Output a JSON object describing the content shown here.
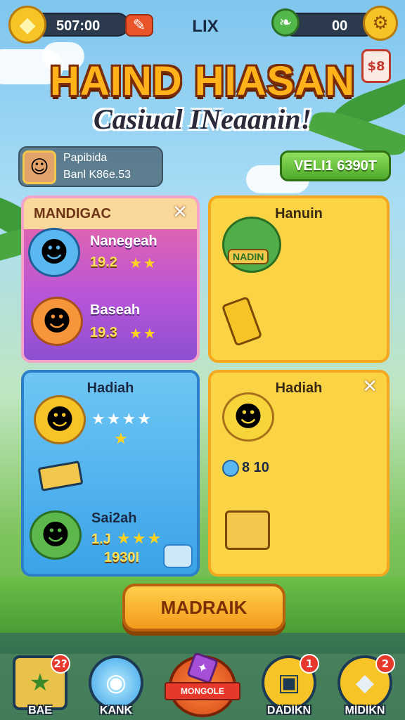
{
  "topbar": {
    "coins_value": "507:00",
    "title": "LIX",
    "gems_value": "00",
    "coin_icon": "diamond-coin-icon",
    "gem_icon": "leaf-gem-icon"
  },
  "header": {
    "title": "HAIND HIASAN",
    "subtitle": "Casiual INeaanin!",
    "badge_text": "$8"
  },
  "player": {
    "name": "Papibida",
    "score": "Banl K86e.53"
  },
  "green_button": "VELI1 6390T",
  "panels": {
    "magic": {
      "title": "MANDIGAC",
      "items": [
        {
          "name": "Nanegeah",
          "value": "19.2"
        },
        {
          "name": "Baseah",
          "value": "19.3"
        }
      ]
    },
    "hanuin": {
      "title": "Hanuin",
      "badge_text": "NADIN"
    },
    "hadiah_blue": {
      "title": "Hadiah",
      "item_name": "Sai2ah",
      "values_top": "1.J",
      "values_bottom": "1930I"
    },
    "hadiah_yellow": {
      "title": "Hadiah",
      "value": "8 10"
    }
  },
  "main_button": "MADRAIK",
  "nav": [
    {
      "label": "BAE",
      "badge": "2?",
      "icon": "star-icon"
    },
    {
      "label": "KANK",
      "badge": "",
      "icon": "globe-icon"
    },
    {
      "label": "MONGOLE",
      "badge": "",
      "icon": "gem-ribbon-icon"
    },
    {
      "label": "DADIKN",
      "badge": "1",
      "icon": "chest-icon"
    },
    {
      "label": "MIDIKN",
      "badge": "2",
      "icon": "crystal-icon"
    }
  ],
  "colors": {
    "accent_orange": "#f39a1c",
    "panel_yellow": "#fbd446",
    "panel_blue": "#3aa3e8",
    "panel_purple": "#b855d8",
    "sky": "#7fc6ee"
  }
}
